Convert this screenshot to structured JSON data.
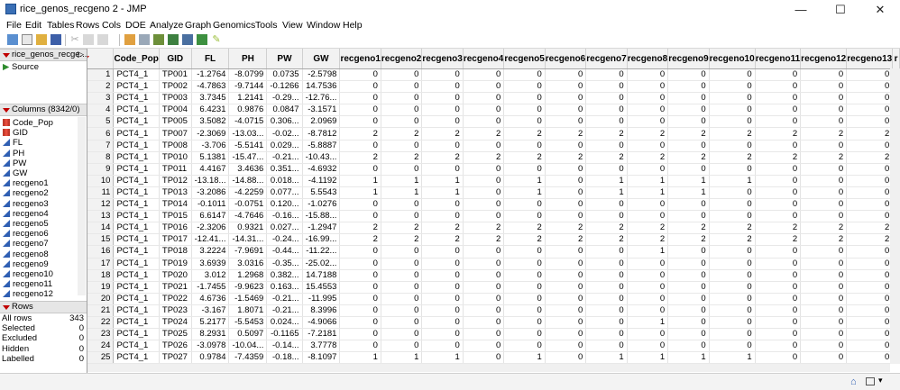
{
  "window": {
    "title": "rice_genos_recgeno 2 - JMP",
    "minimize": "—",
    "maximize": "☐",
    "close": "✕"
  },
  "menu": [
    "File",
    "Edit",
    "Tables",
    "Rows",
    "Cols",
    "DOE",
    "Analyze",
    "Graph",
    "Genomics",
    "Tools",
    "View",
    "Window",
    "Help"
  ],
  "table_panel": {
    "title": "rice_genos_recge...",
    "source": "Source"
  },
  "columns_panel": {
    "title": "Columns (8342/0)",
    "items": [
      {
        "name": "Code_Pop",
        "type": "nominal"
      },
      {
        "name": "GID",
        "type": "nominal"
      },
      {
        "name": "FL",
        "type": "continuous"
      },
      {
        "name": "PH",
        "type": "continuous"
      },
      {
        "name": "PW",
        "type": "continuous"
      },
      {
        "name": "GW",
        "type": "continuous"
      },
      {
        "name": "recgeno1",
        "type": "continuous"
      },
      {
        "name": "recgeno2",
        "type": "continuous"
      },
      {
        "name": "recgeno3",
        "type": "continuous"
      },
      {
        "name": "recgeno4",
        "type": "continuous"
      },
      {
        "name": "recgeno5",
        "type": "continuous"
      },
      {
        "name": "recgeno6",
        "type": "continuous"
      },
      {
        "name": "recgeno7",
        "type": "continuous"
      },
      {
        "name": "recgeno8",
        "type": "continuous"
      },
      {
        "name": "recgeno9",
        "type": "continuous"
      },
      {
        "name": "recgeno10",
        "type": "continuous"
      },
      {
        "name": "recgeno11",
        "type": "continuous"
      },
      {
        "name": "recgeno12",
        "type": "continuous"
      }
    ]
  },
  "rows_panel": {
    "title": "Rows",
    "items": [
      {
        "label": "All rows",
        "value": "343"
      },
      {
        "label": "Selected",
        "value": "0"
      },
      {
        "label": "Excluded",
        "value": "0"
      },
      {
        "label": "Hidden",
        "value": "0"
      },
      {
        "label": "Labelled",
        "value": "0"
      }
    ]
  },
  "grid": {
    "headers": [
      "Code_Pop",
      "GID",
      "FL",
      "PH",
      "PW",
      "GW",
      "recgeno1",
      "recgeno2",
      "recgeno3",
      "recgeno4",
      "recgeno5",
      "recgeno6",
      "recgeno7",
      "recgeno8",
      "recgeno9",
      "recgeno10",
      "recgeno11",
      "recgeno12",
      "recgeno13",
      "r"
    ],
    "rows": [
      [
        "1",
        "PCT4_1",
        "TP001",
        "-1.2764",
        "-8.0799",
        "0.0735",
        "-2.5798",
        "0",
        "0",
        "0",
        "0",
        "0",
        "0",
        "0",
        "0",
        "0",
        "0",
        "0",
        "0",
        "0"
      ],
      [
        "2",
        "PCT4_1",
        "TP002",
        "-4.7863",
        "-9.7144",
        "-0.1266",
        "14.7536",
        "0",
        "0",
        "0",
        "0",
        "0",
        "0",
        "0",
        "0",
        "0",
        "0",
        "0",
        "0",
        "0"
      ],
      [
        "3",
        "PCT4_1",
        "TP003",
        "3.7345",
        "1.2141",
        "-0.29...",
        "-12.76...",
        "0",
        "0",
        "0",
        "0",
        "0",
        "0",
        "0",
        "0",
        "0",
        "0",
        "0",
        "0",
        "0"
      ],
      [
        "4",
        "PCT4_1",
        "TP004",
        "6.4231",
        "0.9876",
        "0.0847",
        "-3.1571",
        "0",
        "0",
        "0",
        "0",
        "0",
        "0",
        "0",
        "0",
        "0",
        "0",
        "0",
        "0",
        "0"
      ],
      [
        "5",
        "PCT4_1",
        "TP005",
        "3.5082",
        "-4.0715",
        "0.306...",
        "2.0969",
        "0",
        "0",
        "0",
        "0",
        "0",
        "0",
        "0",
        "0",
        "0",
        "0",
        "0",
        "0",
        "0"
      ],
      [
        "6",
        "PCT4_1",
        "TP007",
        "-2.3069",
        "-13.03...",
        "-0.02...",
        "-8.7812",
        "2",
        "2",
        "2",
        "2",
        "2",
        "2",
        "2",
        "2",
        "2",
        "2",
        "2",
        "2",
        "2"
      ],
      [
        "7",
        "PCT4_1",
        "TP008",
        "-3.706",
        "-5.5141",
        "0.029...",
        "-5.8887",
        "0",
        "0",
        "0",
        "0",
        "0",
        "0",
        "0",
        "0",
        "0",
        "0",
        "0",
        "0",
        "0"
      ],
      [
        "8",
        "PCT4_1",
        "TP010",
        "5.1381",
        "-15.47...",
        "-0.21...",
        "-10.43...",
        "2",
        "2",
        "2",
        "2",
        "2",
        "2",
        "2",
        "2",
        "2",
        "2",
        "2",
        "2",
        "2"
      ],
      [
        "9",
        "PCT4_1",
        "TP011",
        "4.4167",
        "3.4636",
        "0.351...",
        "-4.6932",
        "0",
        "0",
        "0",
        "0",
        "0",
        "0",
        "0",
        "0",
        "0",
        "0",
        "0",
        "0",
        "0"
      ],
      [
        "10",
        "PCT4_1",
        "TP012",
        "-13.18...",
        "-14.88...",
        "0.018...",
        "-4.1192",
        "1",
        "1",
        "1",
        "0",
        "1",
        "0",
        "1",
        "1",
        "1",
        "1",
        "0",
        "0",
        "0"
      ],
      [
        "11",
        "PCT4_1",
        "TP013",
        "-3.2086",
        "-4.2259",
        "0.077...",
        "5.5543",
        "1",
        "1",
        "1",
        "0",
        "1",
        "0",
        "1",
        "1",
        "1",
        "0",
        "0",
        "0",
        "0"
      ],
      [
        "12",
        "PCT4_1",
        "TP014",
        "-0.1011",
        "-0.0751",
        "0.120...",
        "-1.0276",
        "0",
        "0",
        "0",
        "0",
        "0",
        "0",
        "0",
        "0",
        "0",
        "0",
        "0",
        "0",
        "0"
      ],
      [
        "13",
        "PCT4_1",
        "TP015",
        "6.6147",
        "-4.7646",
        "-0.16...",
        "-15.88...",
        "0",
        "0",
        "0",
        "0",
        "0",
        "0",
        "0",
        "0",
        "0",
        "0",
        "0",
        "0",
        "0"
      ],
      [
        "14",
        "PCT4_1",
        "TP016",
        "-2.3206",
        "0.9321",
        "0.027...",
        "-1.2947",
        "2",
        "2",
        "2",
        "2",
        "2",
        "2",
        "2",
        "2",
        "2",
        "2",
        "2",
        "2",
        "2"
      ],
      [
        "15",
        "PCT4_1",
        "TP017",
        "-12.41...",
        "-14.31...",
        "-0.24...",
        "-16.99...",
        "2",
        "2",
        "2",
        "2",
        "2",
        "2",
        "2",
        "2",
        "2",
        "2",
        "2",
        "2",
        "2"
      ],
      [
        "16",
        "PCT4_1",
        "TP018",
        "3.2224",
        "-7.9691",
        "-0.44...",
        "-11.22...",
        "0",
        "0",
        "0",
        "0",
        "0",
        "0",
        "0",
        "1",
        "0",
        "0",
        "0",
        "0",
        "0"
      ],
      [
        "17",
        "PCT4_1",
        "TP019",
        "3.6939",
        "3.0316",
        "-0.35...",
        "-25.02...",
        "0",
        "0",
        "0",
        "0",
        "0",
        "0",
        "0",
        "0",
        "0",
        "0",
        "0",
        "0",
        "0"
      ],
      [
        "18",
        "PCT4_1",
        "TP020",
        "3.012",
        "1.2968",
        "0.382...",
        "14.7188",
        "0",
        "0",
        "0",
        "0",
        "0",
        "0",
        "0",
        "0",
        "0",
        "0",
        "0",
        "0",
        "0"
      ],
      [
        "19",
        "PCT4_1",
        "TP021",
        "-1.7455",
        "-9.9623",
        "0.163...",
        "15.4553",
        "0",
        "0",
        "0",
        "0",
        "0",
        "0",
        "0",
        "0",
        "0",
        "0",
        "0",
        "0",
        "0"
      ],
      [
        "20",
        "PCT4_1",
        "TP022",
        "4.6736",
        "-1.5469",
        "-0.21...",
        "-11.995",
        "0",
        "0",
        "0",
        "0",
        "0",
        "0",
        "0",
        "0",
        "0",
        "0",
        "0",
        "0",
        "0"
      ],
      [
        "21",
        "PCT4_1",
        "TP023",
        "-3.167",
        "1.8071",
        "-0.21...",
        "8.3996",
        "0",
        "0",
        "0",
        "0",
        "0",
        "0",
        "0",
        "0",
        "0",
        "0",
        "0",
        "0",
        "0"
      ],
      [
        "22",
        "PCT4_1",
        "TP024",
        "5.2177",
        "-5.5453",
        "0.024...",
        "-4.9066",
        "0",
        "0",
        "0",
        "0",
        "0",
        "0",
        "0",
        "1",
        "0",
        "0",
        "0",
        "0",
        "0"
      ],
      [
        "23",
        "PCT4_1",
        "TP025",
        "8.2931",
        "0.5097",
        "-0.1165",
        "-7.2181",
        "0",
        "0",
        "0",
        "0",
        "0",
        "0",
        "0",
        "0",
        "0",
        "0",
        "0",
        "0",
        "0"
      ],
      [
        "24",
        "PCT4_1",
        "TP026",
        "-3.0978",
        "-10.04...",
        "-0.14...",
        "3.7778",
        "0",
        "0",
        "0",
        "0",
        "0",
        "0",
        "0",
        "0",
        "0",
        "0",
        "0",
        "0",
        "0"
      ],
      [
        "25",
        "PCT4_1",
        "TP027",
        "0.9784",
        "-7.4359",
        "-0.18...",
        "-8.1097",
        "1",
        "1",
        "1",
        "0",
        "1",
        "0",
        "1",
        "1",
        "1",
        "1",
        "0",
        "0",
        "0"
      ],
      [
        "26",
        "PCT4_1",
        "TP028",
        "1.4432",
        "-2.5789",
        "-0.16...",
        "6.757",
        "2",
        "2",
        "2",
        "2",
        "2",
        "2",
        "2",
        "2",
        "2",
        "2",
        "2",
        "2",
        "2"
      ]
    ]
  },
  "colors": {
    "accent_red": "#c00000",
    "continuous_icon": "#2f5fb3",
    "nominal_icon": "#c0392b"
  }
}
